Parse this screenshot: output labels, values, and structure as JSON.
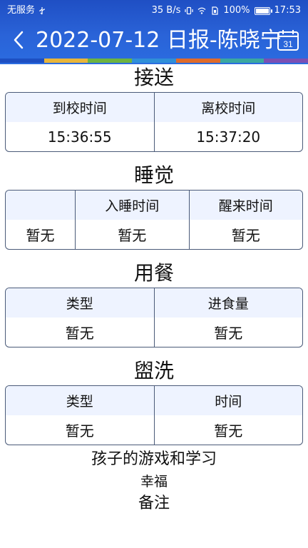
{
  "status_bar": {
    "carrier": "无服务",
    "net_speed": "35 B/s",
    "battery_percent": "100%",
    "battery_level": 1.0,
    "time": "17:53"
  },
  "header": {
    "title": "2022-07-12 日报-陈晓宁",
    "calendar_day": "31",
    "strip_colors": [
      "#1d4fc2",
      "#e8b53a",
      "#6db33f",
      "#2f8fd8",
      "#e06b2a",
      "#3aa8a0",
      "#7b4fb3"
    ]
  },
  "sections": {
    "transfer": {
      "title": "接送",
      "headers": [
        "到校时间",
        "离校时间"
      ],
      "values": [
        "15:36:55",
        "15:37:20"
      ]
    },
    "sleep": {
      "title": "睡觉",
      "headers": [
        "",
        "入睡时间",
        "醒来时间"
      ],
      "values": [
        "暂无",
        "暂无",
        "暂无"
      ]
    },
    "meal": {
      "title": "用餐",
      "headers": [
        "类型",
        "进食量"
      ],
      "values": [
        "暂无",
        "暂无"
      ]
    },
    "wash": {
      "title": "盥洗",
      "headers": [
        "类型",
        "时间"
      ],
      "values": [
        "暂无",
        "暂无"
      ]
    }
  },
  "games_title": "孩子的游戏和学习",
  "games_value": "幸福",
  "remarks_title": "备注"
}
